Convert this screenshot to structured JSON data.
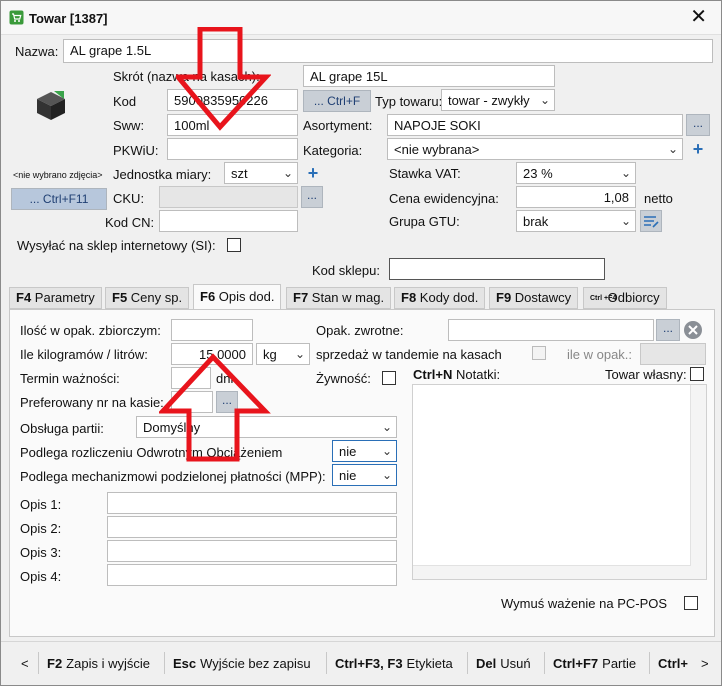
{
  "window": {
    "title": "Towar [1387]",
    "close_glyph": "✕",
    "icon": "cart-icon"
  },
  "product": {
    "name_label": "Nazwa:",
    "name_value": "AL grape 1.5L",
    "short_label": "Skrót (nazwa na kasach):",
    "short_value": "AL grape 15L",
    "code_label": "Kod",
    "code_value": "5900835950226",
    "ctrl_f_btn": "... Ctrl+F",
    "type_label": "Typ towaru:",
    "type_value": "towar - zwykły",
    "sww_label": "Sww:",
    "sww_value": "100ml",
    "assortment_label": "Asortyment:",
    "assortment_value": "NAPOJE SOKI",
    "pkwiu_label": "PKWiU:",
    "pkwiu_value": "",
    "category_label": "Kategoria:",
    "category_value": "<nie wybrana>",
    "no_photo": "<nie wybrano zdjęcia>",
    "unit_label": "Jednostka miary:",
    "unit_value": "szt",
    "vat_label": "Stawka VAT:",
    "vat_value": "23 %",
    "photo_btn": "... Ctrl+F11",
    "cku_label": "CKU:",
    "price_label": "Cena ewidencyjna:",
    "price_value": "1,08",
    "netto": "netto",
    "cn_label": "Kod CN:",
    "cn_value": "",
    "gtu_label": "Grupa GTU:",
    "gtu_value": "brak",
    "send_shop_label": "Wysyłać na sklep internetowy (SI):",
    "shop_code_label": "Kod sklepu:",
    "shop_code_value": ""
  },
  "tabs": [
    {
      "key": "F4",
      "label": "Parametry"
    },
    {
      "key": "F5",
      "label": "Ceny sp."
    },
    {
      "key": "F6",
      "label": "Opis dod."
    },
    {
      "key": "F7",
      "label": "Stan w mag."
    },
    {
      "key": "F8",
      "label": "Kody dod."
    },
    {
      "key": "F9",
      "label": "Dostawcy"
    },
    {
      "key": "Ctrl +F4",
      "label": "Odbiorcy"
    }
  ],
  "active_tab": "F6",
  "panel": {
    "bulk_qty_label": "Ilość w opak. zbiorczym:",
    "bulk_qty_value": "",
    "kg_label": "Ile kilogramów / litrów:",
    "kg_value": "15,0000",
    "kg_unit": "kg",
    "expiry_label": "Termin ważności:",
    "expiry_unit": "dni",
    "pos_nr_label": "Preferowany nr na kasie:",
    "partia_label": "Obsługa partii:",
    "partia_value": "Domyślny",
    "reverse_label": "Podlega rozliczeniu Odwrotnym Obciążeniem",
    "reverse_value": "nie",
    "mpp_label": "Podlega mechanizmowi podzielonej płatności (MPP):",
    "mpp_value": "nie",
    "opis": [
      "Opis 1:",
      "Opis 2:",
      "Opis 3:",
      "Opis 4:"
    ],
    "returnable_label": "Opak. zwrotne:",
    "tandem_label": "sprzedaż w tandemie na kasach",
    "per_pack_label": "ile w opak.:",
    "food_label": "Żywność:",
    "notes_key": "Ctrl+N",
    "notes_label": "Notatki:",
    "own_product_label": "Towar własny:",
    "weigh_label": "Wymuś ważenie na PC-POS"
  },
  "statusbar": [
    {
      "key": "F2",
      "label": "Zapis i wyjście"
    },
    {
      "key": "Esc",
      "label": "Wyjście bez zapisu"
    },
    {
      "key": "Ctrl+F3, F3",
      "label": "Etykieta"
    },
    {
      "key": "Del",
      "label": "Usuń"
    },
    {
      "key": "Ctrl+F7",
      "label": "Partie"
    },
    {
      "key": "Ctrl+",
      "label": ""
    }
  ],
  "statusbar_nav": {
    "prev": "<",
    "next": ">"
  },
  "colors": {
    "accent": "#2a6fb7",
    "arrow": "#e8141c"
  }
}
